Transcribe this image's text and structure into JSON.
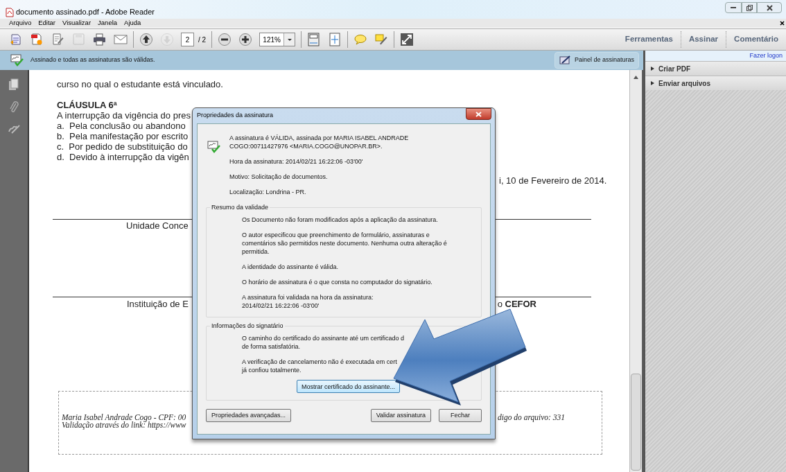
{
  "window": {
    "title": "documento assinado.pdf - Adobe Reader"
  },
  "menu": [
    "Arquivo",
    "Editar",
    "Visualizar",
    "Janela",
    "Ajuda"
  ],
  "toolbar": {
    "groups": [
      [
        {
          "kind": "open",
          "disabled": false
        },
        {
          "kind": "create",
          "disabled": false
        },
        {
          "kind": "edit",
          "disabled": false
        },
        {
          "kind": "save",
          "disabled": true
        },
        {
          "kind": "print",
          "disabled": false
        },
        {
          "kind": "email",
          "disabled": false
        }
      ],
      [
        {
          "kind": "prev",
          "disabled": false
        },
        {
          "kind": "next",
          "disabled": true
        },
        {
          "kind": "page_field",
          "value": "2"
        },
        {
          "kind": "page_total",
          "text": "/ 2"
        }
      ],
      [
        {
          "kind": "zoom_out",
          "disabled": false
        },
        {
          "kind": "zoom_in",
          "disabled": false
        },
        {
          "kind": "zoom_field",
          "value": "121%"
        }
      ],
      [
        {
          "kind": "fit_width",
          "disabled": false
        },
        {
          "kind": "fit_page",
          "disabled": false
        }
      ],
      [
        {
          "kind": "comment",
          "disabled": false
        },
        {
          "kind": "highlight",
          "disabled": false
        }
      ],
      [
        {
          "kind": "fullscreen",
          "disabled": false
        }
      ]
    ],
    "tasks": [
      "Ferramentas",
      "Assinar",
      "Comentário"
    ]
  },
  "notification": {
    "text": "Assinado e todas as assinaturas são válidas.",
    "button": "Painel de assinaturas"
  },
  "right_pane": {
    "login_link": "Fazer logon",
    "sections": [
      {
        "label": "Criar PDF",
        "expanded": false
      },
      {
        "label": "Enviar arquivos",
        "expanded": false
      }
    ]
  },
  "document": {
    "lines": [
      "curso no qual o estudante está vinculado."
    ],
    "clause_title": "CLÁUSULA 6ª",
    "clause_lines": [
      "A interrupção da vigência do pres",
      "a.  Pela conclusão ou abandono",
      "b.  Pela manifestação por escrito",
      "c.  Por pedido de substituição do",
      "d.  Devido à interrupção da vigên"
    ],
    "date": "i, 10 de Fevereiro de 2014.",
    "signature_1": "Unidade Conce",
    "signature_2": "Instituição de E",
    "signature_2_right": "o **CEFOR**",
    "stamp_line_1": "Maria Isabel Andrade Cogo - CPF: 00",
    "stamp_line_1_right": "digo do arquivo: 331",
    "stamp_line_2": "Validação através do link: https://www"
  },
  "dialog": {
    "title": "Propriedades da assinatura",
    "header": [
      "A assinatura é VÁLIDA, assinada por MARIA ISABEL ANDRADE\nCOGO:00711427976 <MARIA.COGO@UNOPAR.BR>.",
      "Hora da assinatura:  2014/02/21 16:22:06 -03'00'",
      "Motivo: Solicitação de documentos.",
      "Localização:  Londrina - PR."
    ],
    "groups": [
      {
        "title": "Resumo da validade",
        "items": [
          "Os Documento não foram modificados após a aplicação da assinatura.",
          "O autor especificou que preenchimento de formulário, assinaturas e\ncomentários são permitidos neste documento. Nenhuma outra alteração é\npermitida.",
          "A identidade do assinante é válida.",
          "O horário de assinatura é o que consta no computador do signatário.",
          "A assinatura foi validada na hora da assinatura:\n2014/02/21 16:22:06 -03'00'"
        ]
      },
      {
        "title": "Informações do signatário",
        "items": [
          "O caminho do certificado do assinante até um certificado d\nde forma satisfatória.",
          "A verificação de cancelamento não é executada em cert\njá confiou totalmente."
        ],
        "button": "Mostrar certificado do assinante..."
      }
    ],
    "buttons_left": [
      "Propriedades avançadas..."
    ],
    "buttons_right": [
      "Validar assinatura",
      "Fechar"
    ]
  }
}
